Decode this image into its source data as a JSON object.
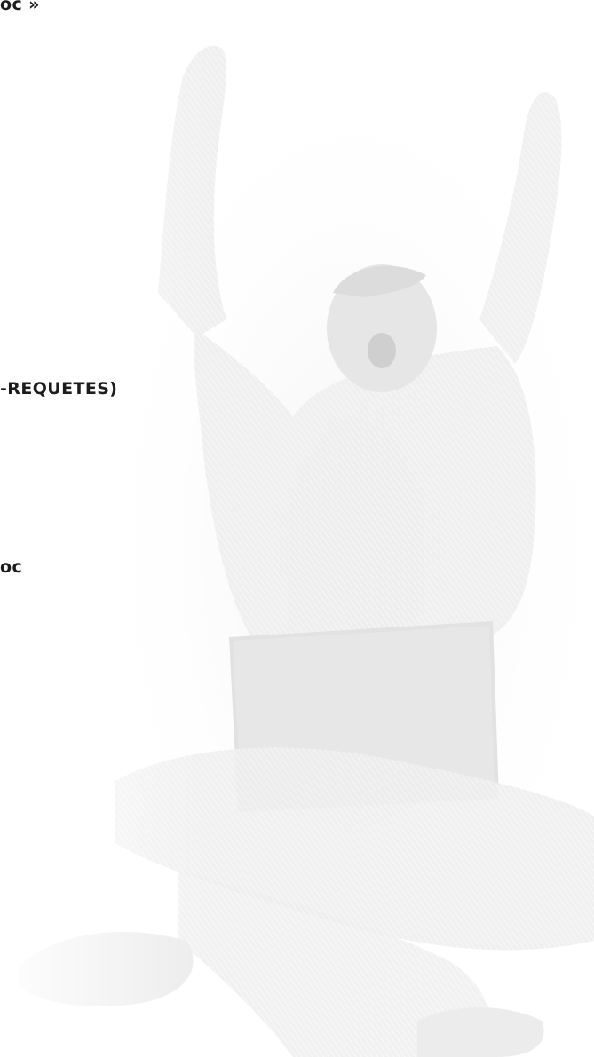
{
  "fragments": {
    "top": "oc »",
    "middle": "-REQUETES)",
    "lower": "oc"
  },
  "image": {
    "icon": "celebrating-person-with-laptop-image"
  }
}
